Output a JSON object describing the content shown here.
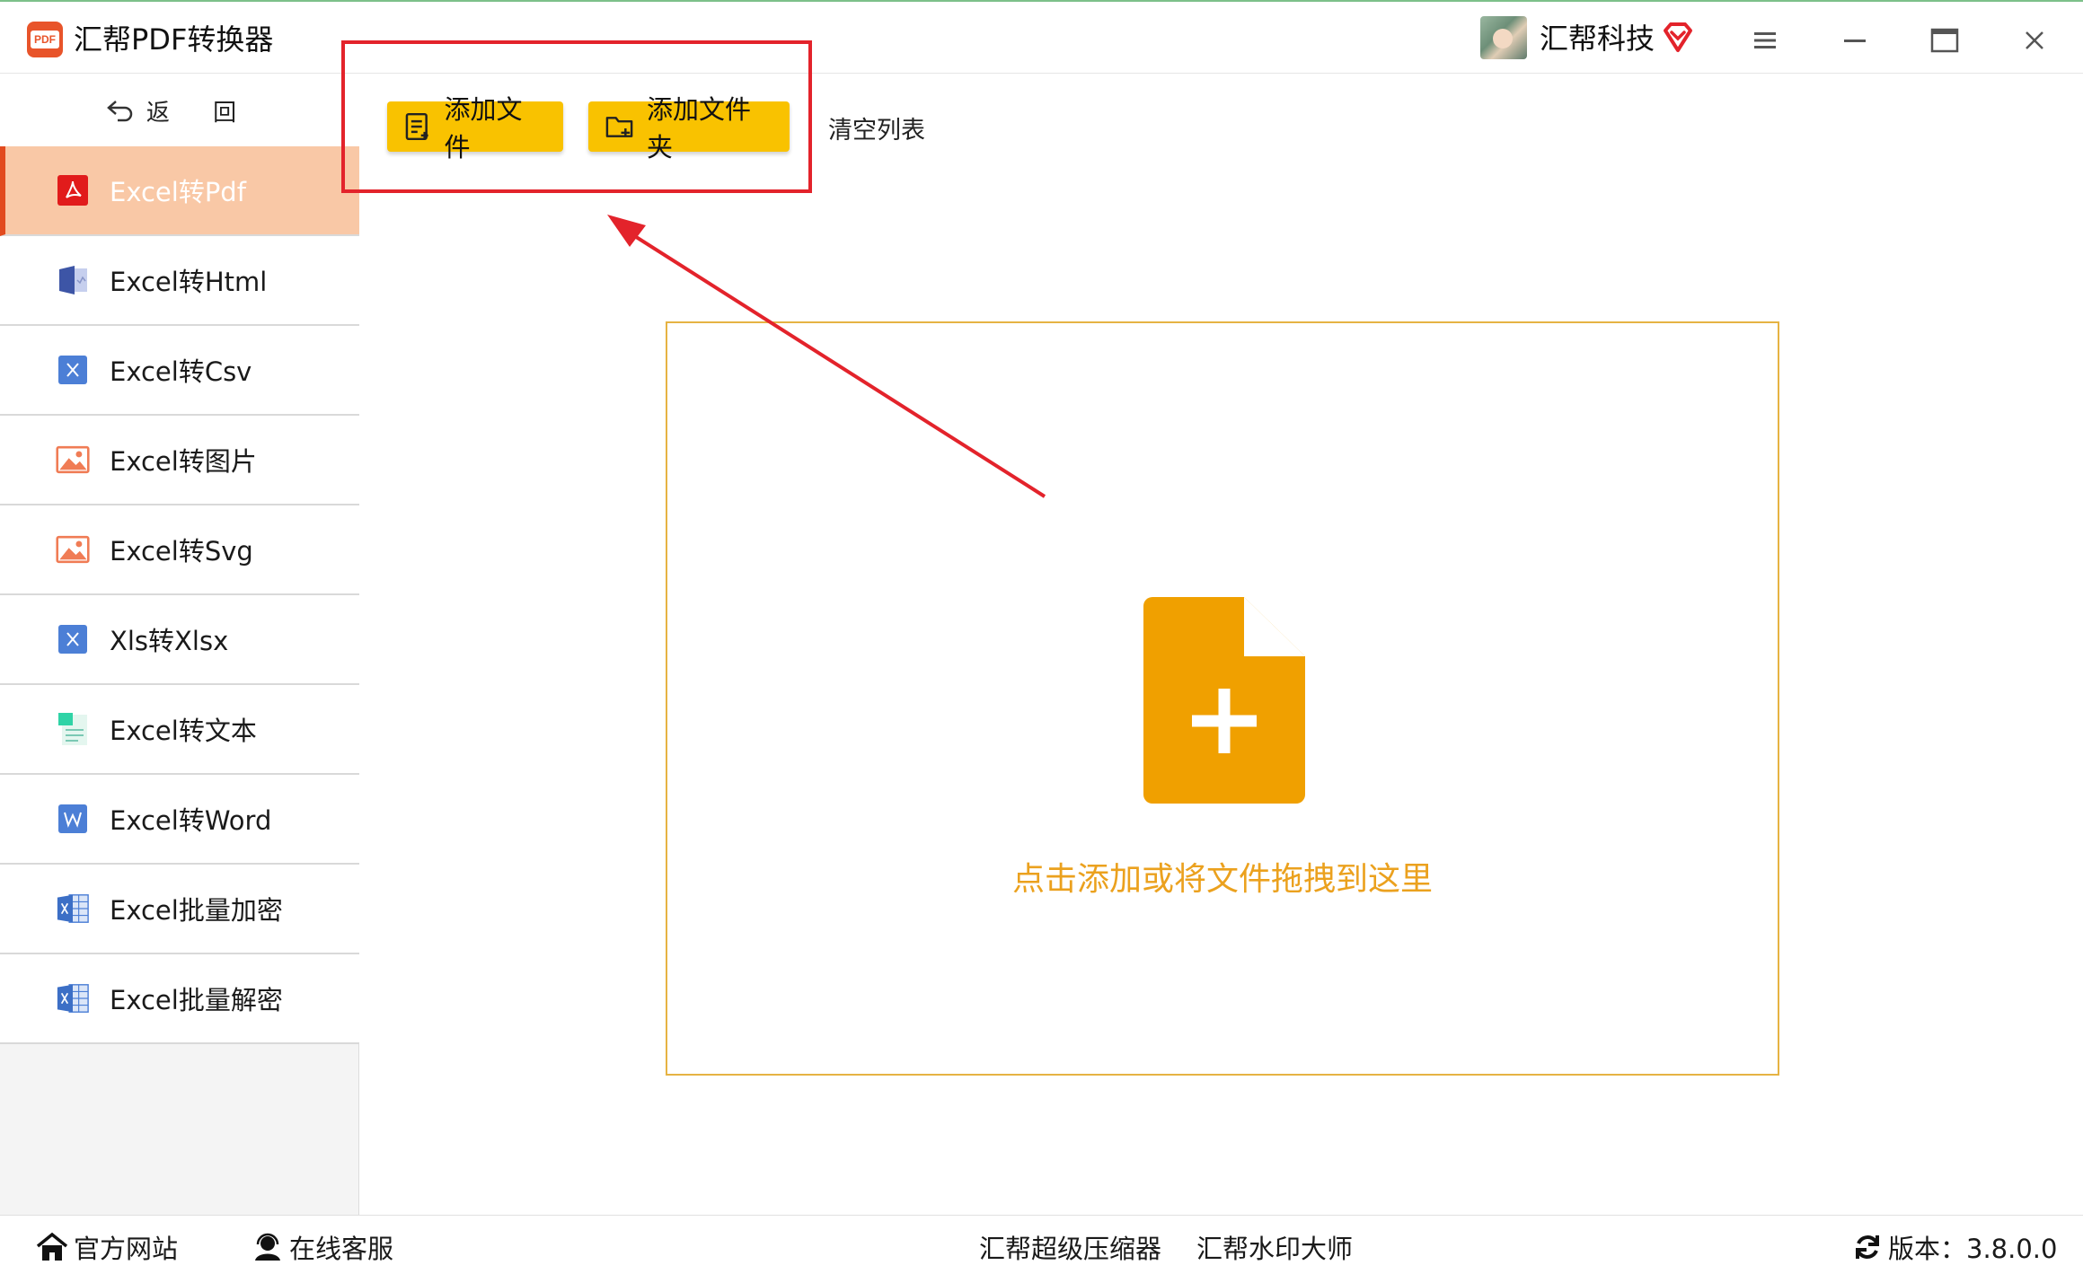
{
  "app": {
    "title": "汇帮PDF转换器",
    "logo_text": "PDF"
  },
  "user": {
    "name": "汇帮科技"
  },
  "sidebar": {
    "back_label": "返 回",
    "items": [
      {
        "label": "Excel转Pdf",
        "icon": "pdf-icon"
      },
      {
        "label": "Excel转Html",
        "icon": "html-icon"
      },
      {
        "label": "Excel转Csv",
        "icon": "csv-icon"
      },
      {
        "label": "Excel转图片",
        "icon": "image-icon"
      },
      {
        "label": "Excel转Svg",
        "icon": "image-icon"
      },
      {
        "label": "Xls转Xlsx",
        "icon": "excel-icon"
      },
      {
        "label": "Excel转文本",
        "icon": "text-icon"
      },
      {
        "label": "Excel转Word",
        "icon": "word-icon"
      },
      {
        "label": "Excel批量加密",
        "icon": "excel-grid-icon"
      },
      {
        "label": "Excel批量解密",
        "icon": "excel-grid-icon"
      }
    ],
    "active_index": 0
  },
  "toolbar": {
    "add_file": "添加文件",
    "add_folder": "添加文件夹",
    "clear_list": "清空列表"
  },
  "dropzone": {
    "hint": "点击添加或将文件拖拽到这里"
  },
  "footer": {
    "website": "官方网站",
    "support": "在线客服",
    "compressor": "汇帮超级压缩器",
    "watermark": "汇帮水印大师",
    "version": "版本：3.8.0.0"
  },
  "colors": {
    "accent": "#f9c200",
    "active_bg": "#f9c8a6",
    "active_bar": "#e24a1e",
    "hint": "#eba11e",
    "annotation": "#e3232b"
  }
}
